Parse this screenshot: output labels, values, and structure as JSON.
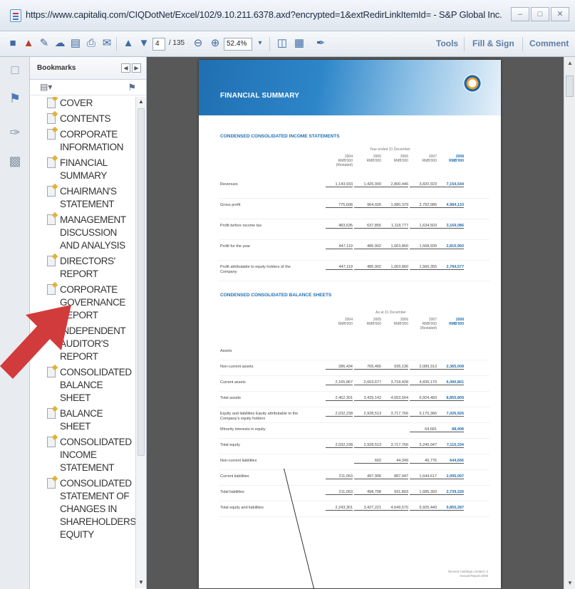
{
  "window": {
    "title": "https://www.capitaliq.com/CIQDotNet/Excel/102/9.10.211.6378.axd?encrypted=1&extRedirLinkItemId= - S&P Global Inc.",
    "buttons": [
      "minimize",
      "restore",
      "close"
    ]
  },
  "toolbar": {
    "page_current": "4",
    "page_total": "/ 135",
    "zoom": "52.4%",
    "tools_label": "Tools",
    "fill_sign_label": "Fill & Sign",
    "comment_label": "Comment"
  },
  "bookmarks_panel": {
    "header": "Bookmarks",
    "items": [
      {
        "label": "COVER"
      },
      {
        "label": "CONTENTS"
      },
      {
        "label": "CORPORATE INFORMATION"
      },
      {
        "label": "FINANCIAL SUMMARY"
      },
      {
        "label": "CHAIRMAN'S STATEMENT"
      },
      {
        "label": "MANAGEMENT DISCUSSION AND ANALYSIS"
      },
      {
        "label": "DIRECTORS' REPORT"
      },
      {
        "label": "CORPORATE GOVERNANCE REPORT"
      },
      {
        "label": "INDEPENDENT AUDITOR'S REPORT"
      },
      {
        "label": "CONSOLIDATED BALANCE SHEET"
      },
      {
        "label": "BALANCE SHEET"
      },
      {
        "label": "CONSOLIDATED INCOME STATEMENT"
      },
      {
        "label": "CONSOLIDATED STATEMENT OF CHANGES IN SHAREHOLDERS' EQUITY"
      }
    ]
  },
  "document": {
    "banner_title": "FINANCIAL SUMMARY",
    "income_heading": "CONDENSED CONSOLIDATED INCOME STATEMENTS",
    "income_caption": "Year ended 31 December",
    "balance_heading": "CONDENSED CONSOLIDATED BALANCE SHEETS",
    "balance_caption": "As at 31 December",
    "years": [
      "2004",
      "2005",
      "2006",
      "2007",
      "2008"
    ],
    "units": [
      "RMB'000",
      "RMB'000",
      "RMB'000",
      "RMB'000",
      "RMB'000"
    ],
    "restated_note": "(Restated)",
    "income_rows": [
      {
        "label": "Revenues",
        "values": [
          "1,143,933",
          "1,426,000",
          "2,800,446",
          "3,820,923",
          "7,154,544"
        ]
      },
      {
        "label": "Gross profit",
        "values": [
          "775,608",
          "964,026",
          "1,980,379",
          "2,792,986",
          "4,984,133"
        ]
      },
      {
        "label": "Profit before income tax",
        "values": [
          "483,635",
          "637,855",
          "1,118,777",
          "1,634,503",
          "3,169,086"
        ]
      },
      {
        "label": "Profit for the year",
        "values": [
          "447,119",
          "485,902",
          "1,063,860",
          "1,568,939",
          "2,815,950"
        ]
      },
      {
        "label": "Profit attributable to equity holders of the Company",
        "values": [
          "447,119",
          "485,902",
          "1,063,860",
          "1,566,355",
          "2,784,577"
        ]
      }
    ],
    "balance_rows": [
      {
        "label": "Assets",
        "values": [
          "",
          "",
          "",
          "",
          ""
        ]
      },
      {
        "label": "Non-current assets",
        "values": "286,434 | 765,465 | 935,136 | 2,089,313 | 2,365,008"
      },
      {
        "label": "Current assets",
        "values": "2,165,867 | 2,663,677 | 3,718,428 | 4,835,170 | 6,490,801"
      },
      {
        "label": "Total assets",
        "values": "2,452,301 | 3,429,142 | 4,653,564 | 6,924,483 | 8,855,809"
      },
      {
        "label": "Equity and liabilities Equity attributable to the Company's equity holders",
        "values": "2,032,238 | 2,928,513 | 3,717,766 | 5,175,366 | 7,026,926"
      },
      {
        "label": "Minority interests in equity",
        "values": "| | | 64,681 | 88,408"
      },
      {
        "label": "Total equity",
        "values": "2,032,238 | 2,928,513 | 3,717,766 | 5,240,047 | 7,115,334"
      },
      {
        "label": "Non-current liabilities",
        "values": "| 602 | 44,349 | 40,776 | 644,656"
      },
      {
        "label": "Current liabilities",
        "values": "211,063 | 497,906 | 887,447 | 1,644,617 | 2,095,097"
      },
      {
        "label": "Total liabilities",
        "values": "211,063 | 498,708 | 931,803 | 1,685,393 | 2,739,226"
      },
      {
        "label": "Total equity and liabilities",
        "values": "2,243,301 | 3,427,221 | 4,649,570 | 6,925,440 | 9,855,287"
      }
    ],
    "footer": "Tencent Holdings Limited | 3\nAnnual Report 2008"
  },
  "colors": {
    "accent": "#1f6fb2",
    "arrow": "#d23b3b"
  }
}
